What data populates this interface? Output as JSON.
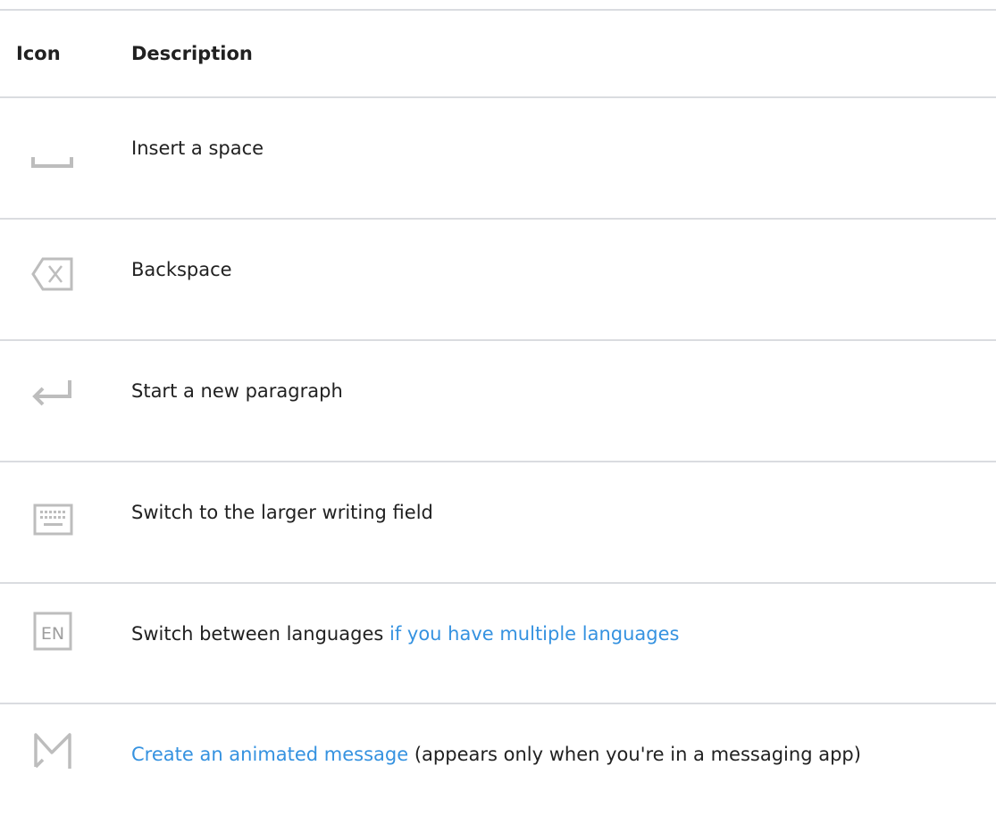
{
  "table": {
    "headers": {
      "icon": "Icon",
      "description": "Description"
    },
    "rows": [
      {
        "icon": "space-bar-icon",
        "parts": [
          {
            "text": "Insert a space",
            "link": false
          }
        ]
      },
      {
        "icon": "backspace-icon",
        "parts": [
          {
            "text": "Backspace",
            "link": false
          }
        ]
      },
      {
        "icon": "enter-arrow-icon",
        "parts": [
          {
            "text": "Start a new paragraph",
            "link": false
          }
        ]
      },
      {
        "icon": "keyboard-icon",
        "parts": [
          {
            "text": "Switch to the larger writing field",
            "link": false
          }
        ]
      },
      {
        "icon": "language-en-icon",
        "parts": [
          {
            "text": "Switch between languages ",
            "link": false
          },
          {
            "text": "if you have multiple languages",
            "link": true
          }
        ]
      },
      {
        "icon": "animated-message-icon",
        "parts": [
          {
            "text": "Create an animated message",
            "link": true
          },
          {
            "text": " (appears only when you're in a messaging app)",
            "link": false
          }
        ]
      }
    ]
  },
  "icon_labels": {
    "language": "EN"
  },
  "colors": {
    "link": "#3592e0",
    "rule": "#dadce0",
    "icon": "#bdbdbd",
    "text": "#212121"
  }
}
